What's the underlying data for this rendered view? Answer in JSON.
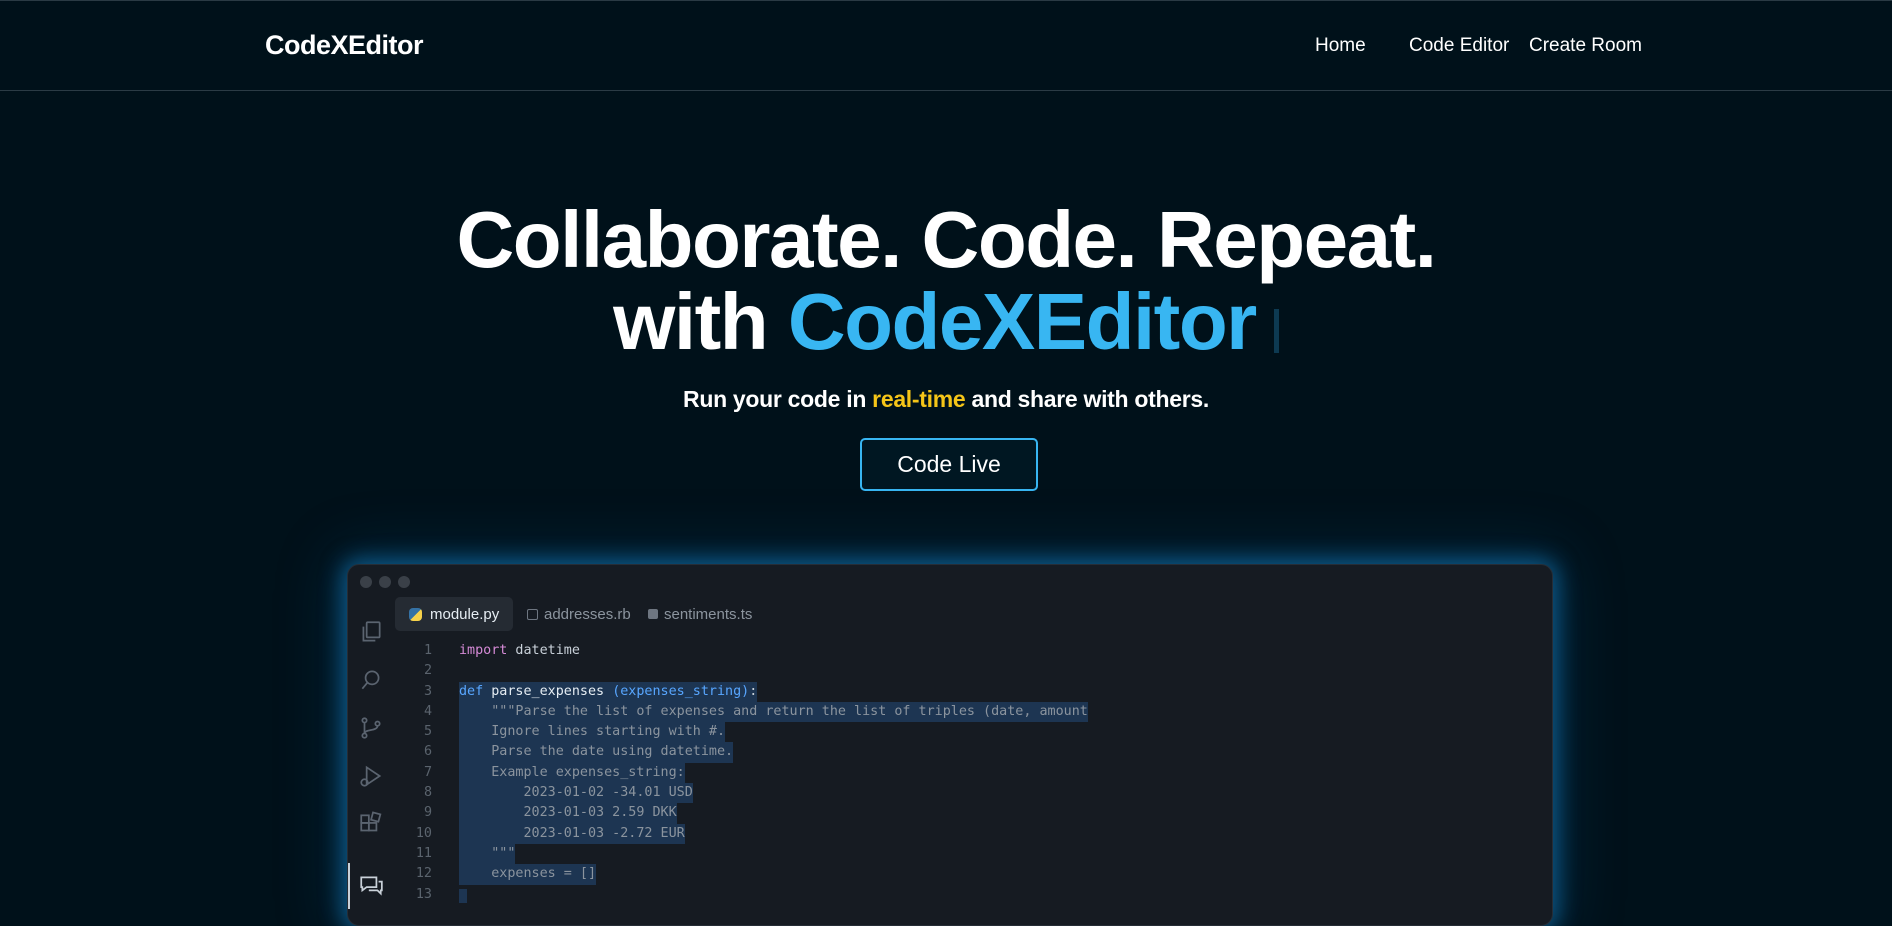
{
  "nav": {
    "brand": "CodeXEditor",
    "links": [
      "Home",
      "Code Editor",
      "Create Room"
    ]
  },
  "hero": {
    "line1": "Collaborate. Code. Repeat.",
    "line2_prefix": "with ",
    "line2_accent": "CodeXEditor",
    "subtitle_pre": "Run your code in ",
    "subtitle_highlight": "real-time",
    "subtitle_post": " and share with others.",
    "cta": "Code Live"
  },
  "colors": {
    "background": "#00111a",
    "accent": "#38b6f2",
    "highlight": "#f5c518"
  },
  "editor": {
    "activity_icons": [
      "files-icon",
      "search-icon",
      "source-control-icon",
      "run-debug-icon",
      "extensions-icon",
      "chat-icon"
    ],
    "tabs": [
      {
        "label": "module.py",
        "icon": "python-icon",
        "active": true
      },
      {
        "label": "addresses.rb",
        "icon": "ruby-file-icon",
        "active": false
      },
      {
        "label": "sentiments.ts",
        "icon": "typescript-file-icon",
        "active": false
      }
    ],
    "lines": [
      {
        "n": "1",
        "kw": "import",
        "rest": " datetime"
      },
      {
        "n": "2",
        "text": ""
      },
      {
        "n": "3",
        "kw": "def",
        "fn": " parse_expenses ",
        "param": "(expenses_string)",
        "end": ":"
      },
      {
        "n": "4",
        "text": "    \"\"\"Parse the list of expenses and return the list of triples (date, amount"
      },
      {
        "n": "5",
        "text": "    Ignore lines starting with #."
      },
      {
        "n": "6",
        "text": "    Parse the date using datetime."
      },
      {
        "n": "7",
        "text": "    Example expenses_string:"
      },
      {
        "n": "8",
        "text": "        2023-01-02 -34.01 USD"
      },
      {
        "n": "9",
        "text": "        2023-01-03 2.59 DKK"
      },
      {
        "n": "10",
        "text": "        2023-01-03 -2.72 EUR"
      },
      {
        "n": "11",
        "text": "    \"\"\""
      },
      {
        "n": "12",
        "text": "    expenses = []"
      },
      {
        "n": "13",
        "text": ""
      }
    ]
  }
}
